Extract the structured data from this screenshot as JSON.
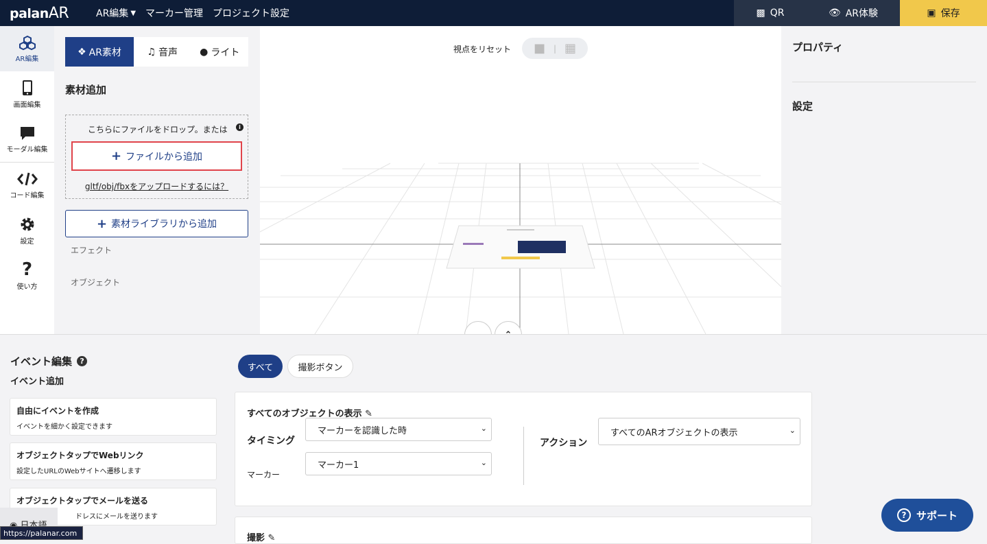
{
  "header": {
    "logo": "palan",
    "logo_ar": "AR",
    "nav": [
      {
        "label": "AR編集",
        "has_dropdown": true
      },
      {
        "label": "マーカー管理"
      },
      {
        "label": "プロジェクト設定"
      }
    ],
    "qr_label": "QR",
    "ar_label": "AR体験",
    "save_label": "保存"
  },
  "left_nav": [
    {
      "label": "AR編集",
      "icon": "cubes-icon",
      "active": true
    },
    {
      "label": "画面編集",
      "icon": "phone-icon"
    },
    {
      "label": "モーダル編集",
      "icon": "speech-bubble-icon"
    },
    {
      "label": "コード編集",
      "icon": "code-icon"
    },
    {
      "label": "設定",
      "icon": "gear-icon"
    },
    {
      "label": "使い方",
      "icon": "question-icon"
    }
  ],
  "asset_panel": {
    "tabs": [
      {
        "label": "AR素材",
        "active": true
      },
      {
        "label": "音声"
      },
      {
        "label": "ライト"
      }
    ],
    "title": "素材追加",
    "drop_hint": "こちらにファイルをドロップ。または",
    "file_button": "ファイルから追加",
    "gltf_link": "gltf/obj/fbxをアップロードするには？",
    "library_button": "素材ライブラリから追加",
    "effect_label": "エフェクト",
    "object_label": "オブジェクト"
  },
  "viewport": {
    "reset_label": "視点をリセット"
  },
  "properties": {
    "title": "プロパティ",
    "settings": "設定"
  },
  "events": {
    "title": "イベント編集",
    "add_title": "イベント追加",
    "cards": [
      {
        "title": "自由にイベントを作成",
        "desc": "イベントを細かく設定できます"
      },
      {
        "title": "オブジェクトタップでWebリンク",
        "desc": "設定したURLのWebサイトへ遷移します"
      },
      {
        "title": "オブジェクトタップでメールを送る",
        "desc": "ドレスにメールを送ります"
      }
    ],
    "filters": [
      "すべて",
      "撮影ボタン"
    ],
    "event1": {
      "title": "すべてのオブジェクトの表示",
      "timing_label": "タイミング",
      "timing_value": "マーカーを認識した時",
      "marker_label": "マーカー",
      "marker_value": "マーカー1",
      "action_label": "アクション",
      "action_value": "すべてのARオブジェクトの表示"
    },
    "event2_title": "撮影"
  },
  "support_label": "サポート",
  "language": "日本語",
  "status_url": "https://palanar.com"
}
